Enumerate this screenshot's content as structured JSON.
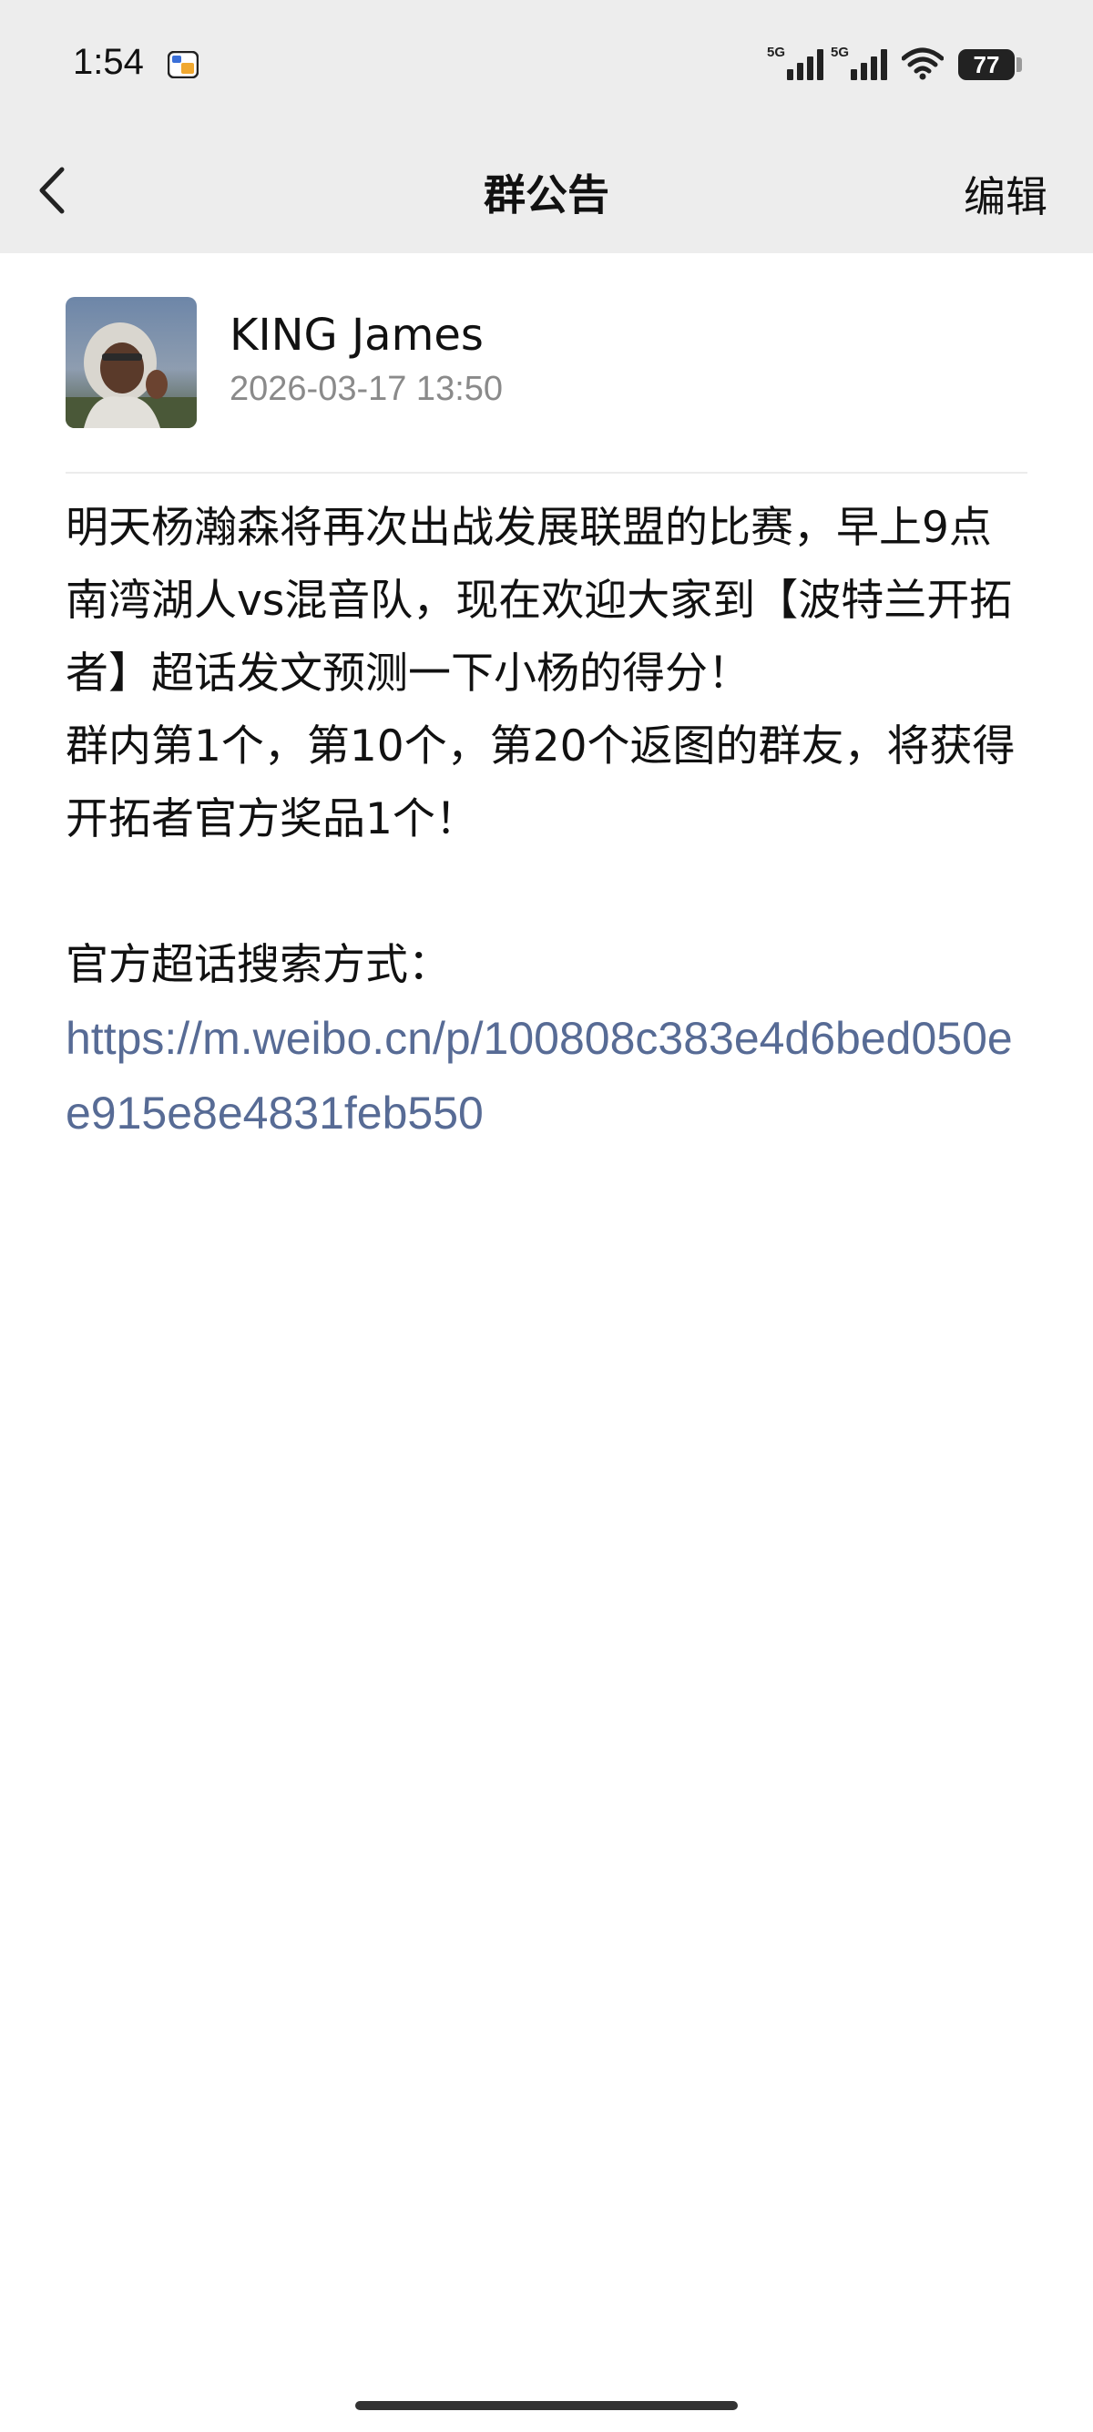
{
  "status_bar": {
    "time": "1:54",
    "signal1_label": "5G",
    "signal2_label": "5G",
    "battery": "77"
  },
  "nav": {
    "title": "群公告",
    "edit_label": "编辑"
  },
  "author": {
    "name": "KING James",
    "timestamp": "2026-03-17 13:50"
  },
  "announcement": {
    "paragraph1": "明天杨瀚森将再次出战发展联盟的比赛，早上9点南湾湖人vs混音队，现在欢迎大家到【波特兰开拓者】超话发文预测一下小杨的得分！",
    "paragraph2": "群内第1个，第10个，第20个返图的群友，将获得开拓者官方奖品1个！",
    "search_label": "官方超话搜索方式：",
    "link": "https://m.weibo.cn/p/100808c383e4d6bed050ee915e8e4831feb550"
  },
  "colors": {
    "header_bg": "#ededed",
    "link": "#576b95",
    "secondary_text": "#8a8a8a"
  }
}
